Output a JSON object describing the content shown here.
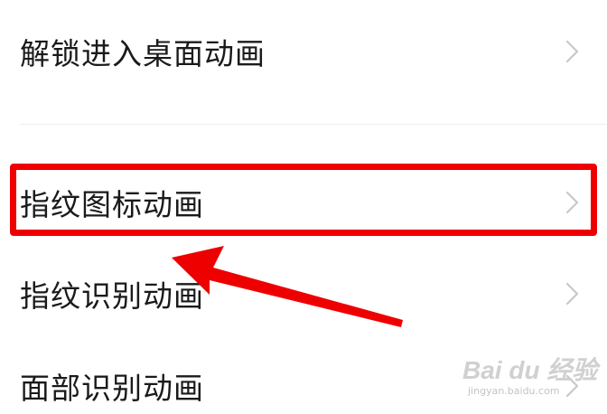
{
  "settings_list": {
    "items": [
      {
        "label": "解锁进入桌面动画"
      },
      {
        "label": "指纹图标动画"
      },
      {
        "label": "指纹识别动画"
      },
      {
        "label": "面部识别动画"
      }
    ]
  },
  "annotation": {
    "highlight_color": "#ee0000",
    "arrow_color": "#ee0000"
  },
  "watermark": {
    "brand": "Bai du 经验",
    "url": "jingyan.baidu.com"
  },
  "icons": {
    "row_chevron": "chevron-right-icon"
  }
}
